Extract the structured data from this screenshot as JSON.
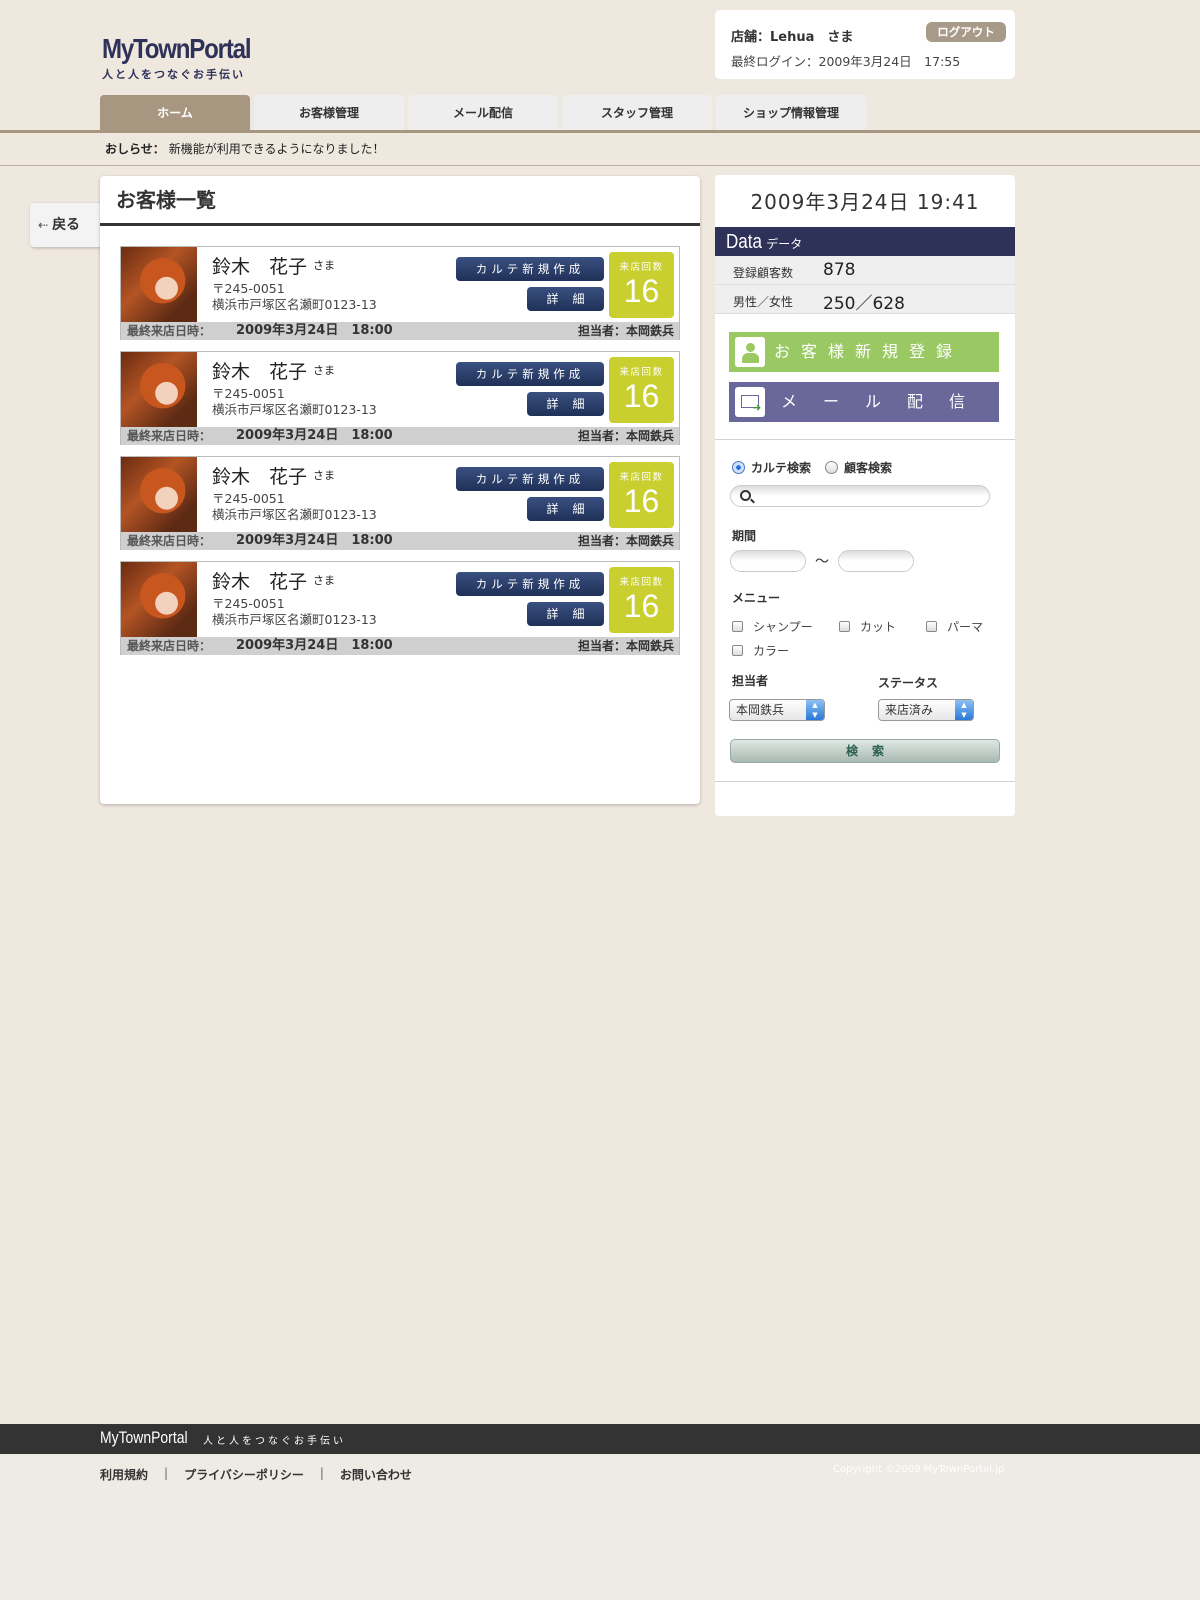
{
  "header": {
    "logo_main": "MyTownPortal",
    "logo_sub": "人と人をつなぐお手伝い",
    "shop_label": "店舗：Lehua　さま",
    "last_login": "最終ログイン：2009年3月24日　17:55",
    "logout_label": "ログアウト"
  },
  "nav": {
    "tabs": [
      {
        "label": "ホーム"
      },
      {
        "label": "お客様管理"
      },
      {
        "label": "メール配信"
      },
      {
        "label": "スタッフ管理"
      },
      {
        "label": "ショップ情報管理"
      }
    ]
  },
  "notice": {
    "label": "おしらせ：",
    "text": "新機能が利用できるようになりました！"
  },
  "back_label": "戻る",
  "main": {
    "title": "お客様一覧",
    "customers": [
      {
        "name": "鈴木　花子",
        "honorific": "さま",
        "zip": "〒245-0051",
        "address": "横浜市戸塚区名瀬町0123-13",
        "karte_label": "カルテ新規作成",
        "detail_label": "詳細",
        "visit_label": "来店回数",
        "visit_count": "16",
        "last_visit_label": "最終来店日時：",
        "last_visit": "2009年3月24日　18:00",
        "staff": "担当者：本岡鉄兵"
      },
      {
        "name": "鈴木　花子",
        "honorific": "さま",
        "zip": "〒245-0051",
        "address": "横浜市戸塚区名瀬町0123-13",
        "karte_label": "カルテ新規作成",
        "detail_label": "詳細",
        "visit_label": "来店回数",
        "visit_count": "16",
        "last_visit_label": "最終来店日時：",
        "last_visit": "2009年3月24日　18:00",
        "staff": "担当者：本岡鉄兵"
      },
      {
        "name": "鈴木　花子",
        "honorific": "さま",
        "zip": "〒245-0051",
        "address": "横浜市戸塚区名瀬町0123-13",
        "karte_label": "カルテ新規作成",
        "detail_label": "詳細",
        "visit_label": "来店回数",
        "visit_count": "16",
        "last_visit_label": "最終来店日時：",
        "last_visit": "2009年3月24日　18:00",
        "staff": "担当者：本岡鉄兵"
      },
      {
        "name": "鈴木　花子",
        "honorific": "さま",
        "zip": "〒245-0051",
        "address": "横浜市戸塚区名瀬町0123-13",
        "karte_label": "カルテ新規作成",
        "detail_label": "詳細",
        "visit_label": "来店回数",
        "visit_count": "16",
        "last_visit_label": "最終来店日時：",
        "last_visit": "2009年3月24日　18:00",
        "staff": "担当者：本岡鉄兵"
      }
    ]
  },
  "side": {
    "clock": "2009年3月24日 19:41",
    "data_title": "Data",
    "data_subtitle": "データ",
    "stats": [
      {
        "label": "登録顧客数",
        "value": "878"
      },
      {
        "label": "男性／女性",
        "value": "250／628"
      }
    ],
    "register_label": "お客様新規登録",
    "mail_label": "メール配信",
    "search": {
      "radio_karte": "カルテ検索",
      "radio_customer": "顧客検索",
      "query": "",
      "period_label": "期間",
      "period_sep": "～",
      "menu_label": "メニュー",
      "menu_options": [
        "シャンプー",
        "カット",
        "パーマ",
        "カラー"
      ],
      "staff_label": "担当者",
      "staff_value": "本岡鉄兵",
      "status_label": "ステータス",
      "status_value": "来店済み",
      "search_label": "検索"
    }
  },
  "footer": {
    "logo": "MyTownPortal",
    "tagline": "人と人をつなぐお手伝い",
    "links": [
      "利用規約",
      "プライバシーポリシー",
      "お問い合わせ"
    ],
    "separator": "|",
    "copyright": "Copyright ©2009 MyTownPortal.jp"
  },
  "colors": {
    "brand_navy": "#2e3158",
    "nav_active": "#a89780",
    "visit_badge": "#c9cf2e",
    "register_green": "#9ac964",
    "mail_purple": "#6a679a"
  }
}
